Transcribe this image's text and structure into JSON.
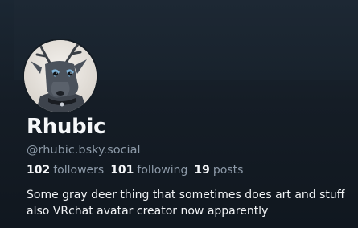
{
  "profile": {
    "display_name": "Rhubic",
    "handle": "@rhubic.bsky.social",
    "avatar_icon": "deer-avatar-image",
    "stats": {
      "followers_count": "102",
      "followers_label": "followers",
      "following_count": "101",
      "following_label": "following",
      "posts_count": "19",
      "posts_label": "posts"
    },
    "bio": [
      "Some gray deer thing that sometimes does art and stuff",
      "also VRchat avatar creator now apparently"
    ]
  },
  "colors": {
    "background": "#151d26",
    "text_primary": "#f1f3f5",
    "text_secondary": "#8d9aa8"
  }
}
